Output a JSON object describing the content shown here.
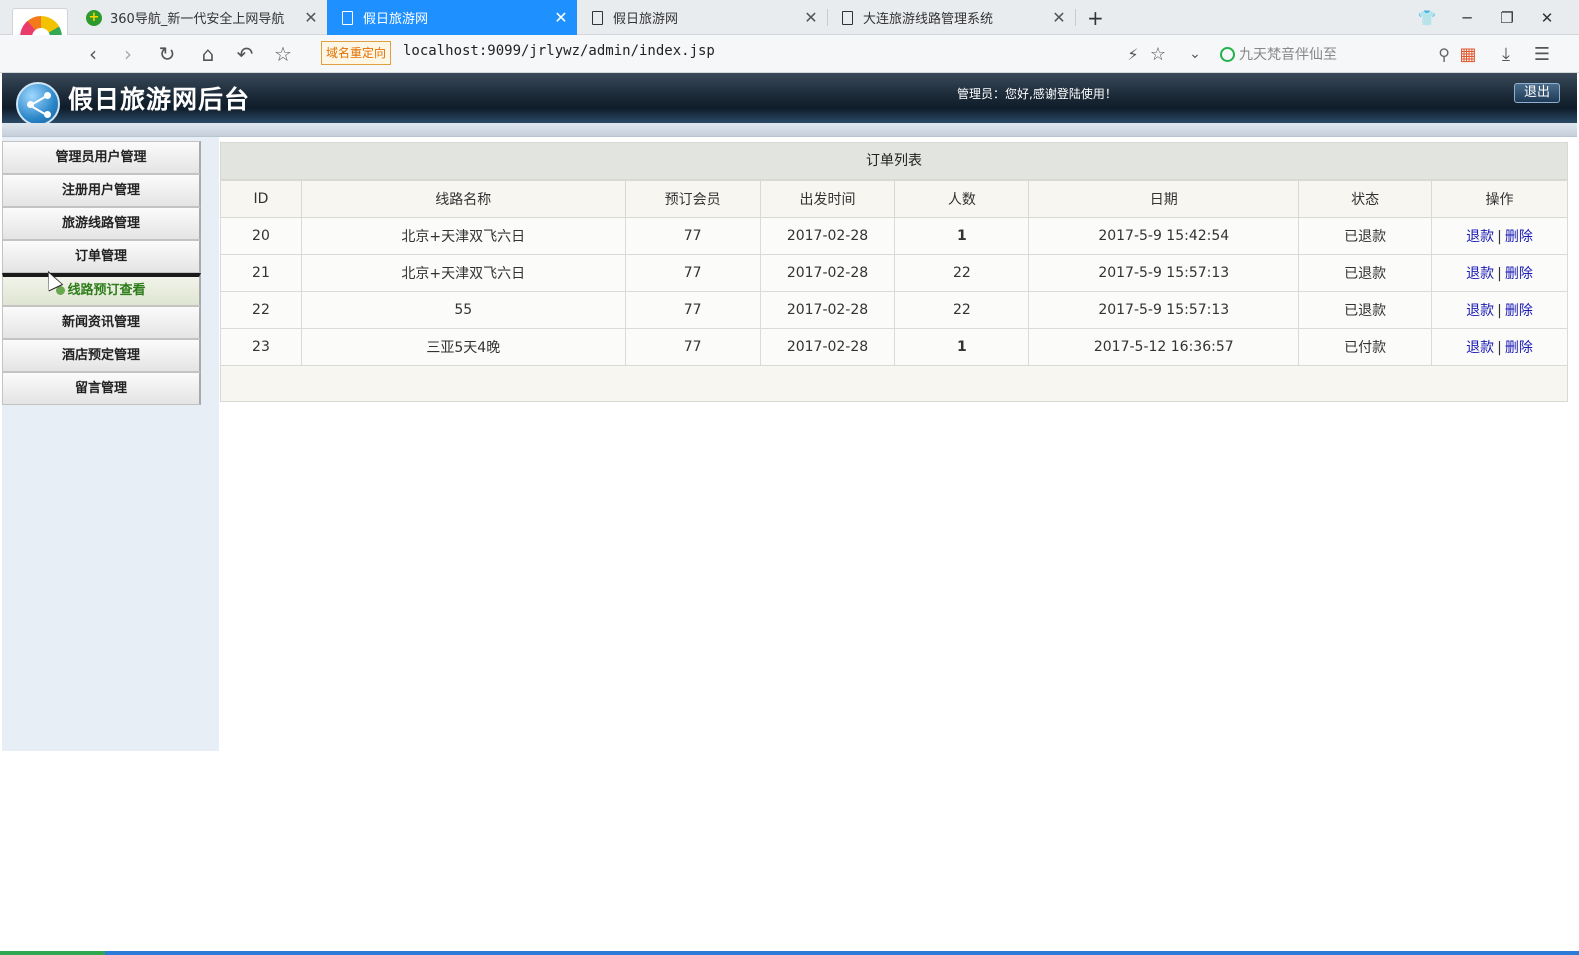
{
  "browser": {
    "tabs": [
      {
        "label": "360导航_新一代安全上网导航",
        "icon": "360-nav-icon",
        "active": false
      },
      {
        "label": "假日旅游网",
        "icon": "document-icon",
        "active": true
      },
      {
        "label": "假日旅游网",
        "icon": "document-icon",
        "active": false
      },
      {
        "label": "大连旅游线路管理系统",
        "icon": "document-icon",
        "active": false
      }
    ],
    "new_tab": "+",
    "domain_badge": "域名重定向",
    "url": "localhost:9099/jrlywz/admin/index.jsp",
    "search_placeholder": "九天梵音伴仙至",
    "accent": "#1e90ff"
  },
  "admin": {
    "title": "假日旅游网后台",
    "welcome": "管理员：您好,感谢登陆使用！",
    "logout": "退出"
  },
  "sidebar": {
    "items": [
      {
        "label": "管理员用户管理",
        "current": false
      },
      {
        "label": "注册用户管理",
        "current": false
      },
      {
        "label": "旅游线路管理",
        "current": false
      },
      {
        "label": "订单管理",
        "current": false
      },
      {
        "label": "线路预订查看",
        "current": true
      },
      {
        "label": "新闻资讯管理",
        "current": false
      },
      {
        "label": "酒店预定管理",
        "current": false
      },
      {
        "label": "留言管理",
        "current": false
      }
    ]
  },
  "orders": {
    "title": "订单列表",
    "columns": [
      "ID",
      "线路名称",
      "预订会员",
      "出发时间",
      "人数",
      "日期",
      "状态",
      "操作"
    ],
    "rows": [
      {
        "id": "20",
        "route": "北京+天津双飞六日",
        "member": "77",
        "depart": "2017-02-28",
        "people": "1",
        "date": "2017-5-9 15:42:54",
        "status": "已退款",
        "refund": "退款",
        "delete": "删除"
      },
      {
        "id": "21",
        "route": "北京+天津双飞六日",
        "member": "77",
        "depart": "2017-02-28",
        "people": "22",
        "date": "2017-5-9 15:57:13",
        "status": "已退款",
        "refund": "退款",
        "delete": "删除"
      },
      {
        "id": "22",
        "route": "55",
        "member": "77",
        "depart": "2017-02-28",
        "people": "22",
        "date": "2017-5-9 15:57:13",
        "status": "已退款",
        "refund": "退款",
        "delete": "删除"
      },
      {
        "id": "23",
        "route": "三亚5天4晚",
        "member": "77",
        "depart": "2017-02-28",
        "people": "1",
        "date": "2017-5-12 16:36:57",
        "status": "已付款",
        "refund": "退款",
        "delete": "删除"
      }
    ],
    "separator": "|"
  }
}
